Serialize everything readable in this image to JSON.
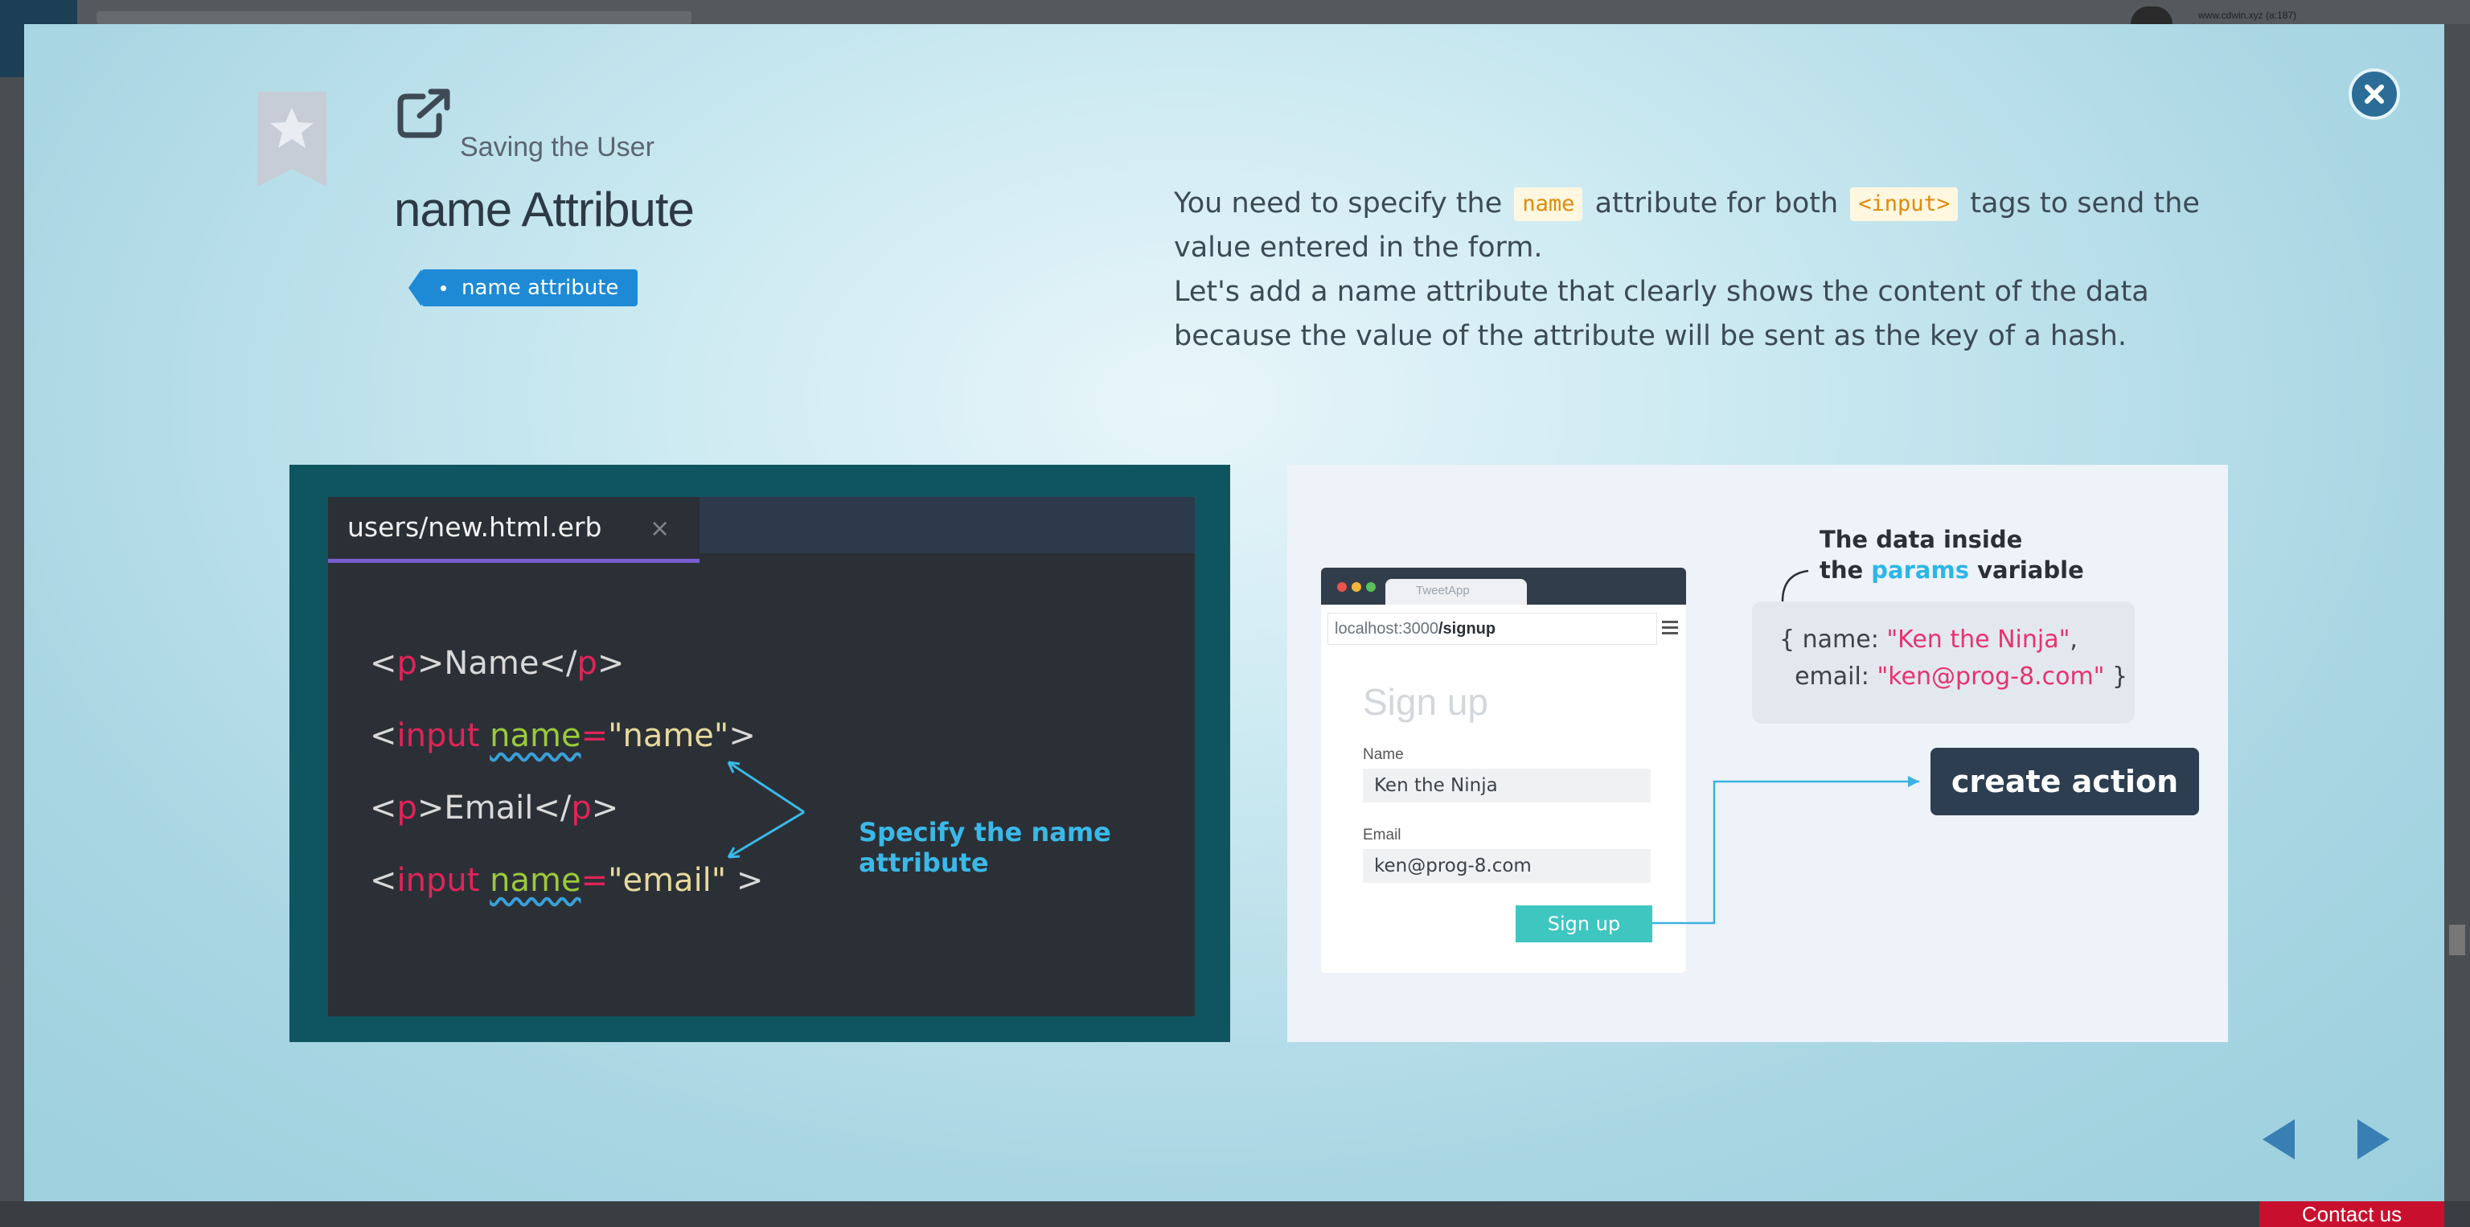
{
  "background": {
    "url_text": "www.cdwin.xyz (a:187)",
    "contact_label": "Contact us"
  },
  "modal": {
    "kicker": "Saving the User",
    "title": "name Attribute",
    "tag": "name attribute",
    "description": {
      "line1_a": "You need to specify the",
      "code1": "name",
      "line1_b": "attribute for both",
      "code2": "<input>",
      "line1_c": "tags to send the value entered in the form.",
      "line2": "Let's add a name attribute that clearly shows the content of the data because the value of the attribute will be sent as the key of a hash."
    }
  },
  "editor": {
    "tab_label": "users/new.html.erb",
    "tab_close": "×",
    "lines": [
      {
        "open": "<",
        "tag": "p",
        "close": ">",
        "text": "Name",
        "end_open": "</",
        "end_tag": "p",
        "end_close": ">"
      },
      {
        "open": "<",
        "tag": "input",
        "attr": "name",
        "eq": "=",
        "value": "\"name\"",
        "close": ">"
      },
      {
        "open": "<",
        "tag": "p",
        "close": ">",
        "text": "Email",
        "end_open": "</",
        "end_tag": "p",
        "end_close": ">"
      },
      {
        "open": "<",
        "tag": "input",
        "attr": "name",
        "eq": "=",
        "value": "\"email\"",
        "close": " >"
      }
    ],
    "annotation": "Specify the name attribute"
  },
  "diagram": {
    "browser_tab": "TweetApp",
    "address_host": "localhost:3000",
    "address_path": "/signup",
    "heading": "Sign up",
    "name_label": "Name",
    "name_value": "Ken the Ninja",
    "email_label": "Email",
    "email_value": "ken@prog-8.com",
    "button": "Sign up",
    "data_label_line1": "The data inside",
    "data_label_the": "the",
    "data_label_params": "params",
    "data_label_variable": "variable",
    "hash_line1_key": "{ name: ",
    "hash_line1_val": "\"Ken the Ninja\"",
    "hash_line1_end": ",",
    "hash_line2_key": "  email: ",
    "hash_line2_val": "\"ken@prog-8.com\"",
    "hash_line2_end": " }",
    "action": "create action"
  },
  "colors": {
    "accent": "#1e8ad6",
    "close": "#2b6d97",
    "nav": "#3a7fb3",
    "editor_bg": "#2b3036",
    "panel_teal": "#0f5560"
  }
}
